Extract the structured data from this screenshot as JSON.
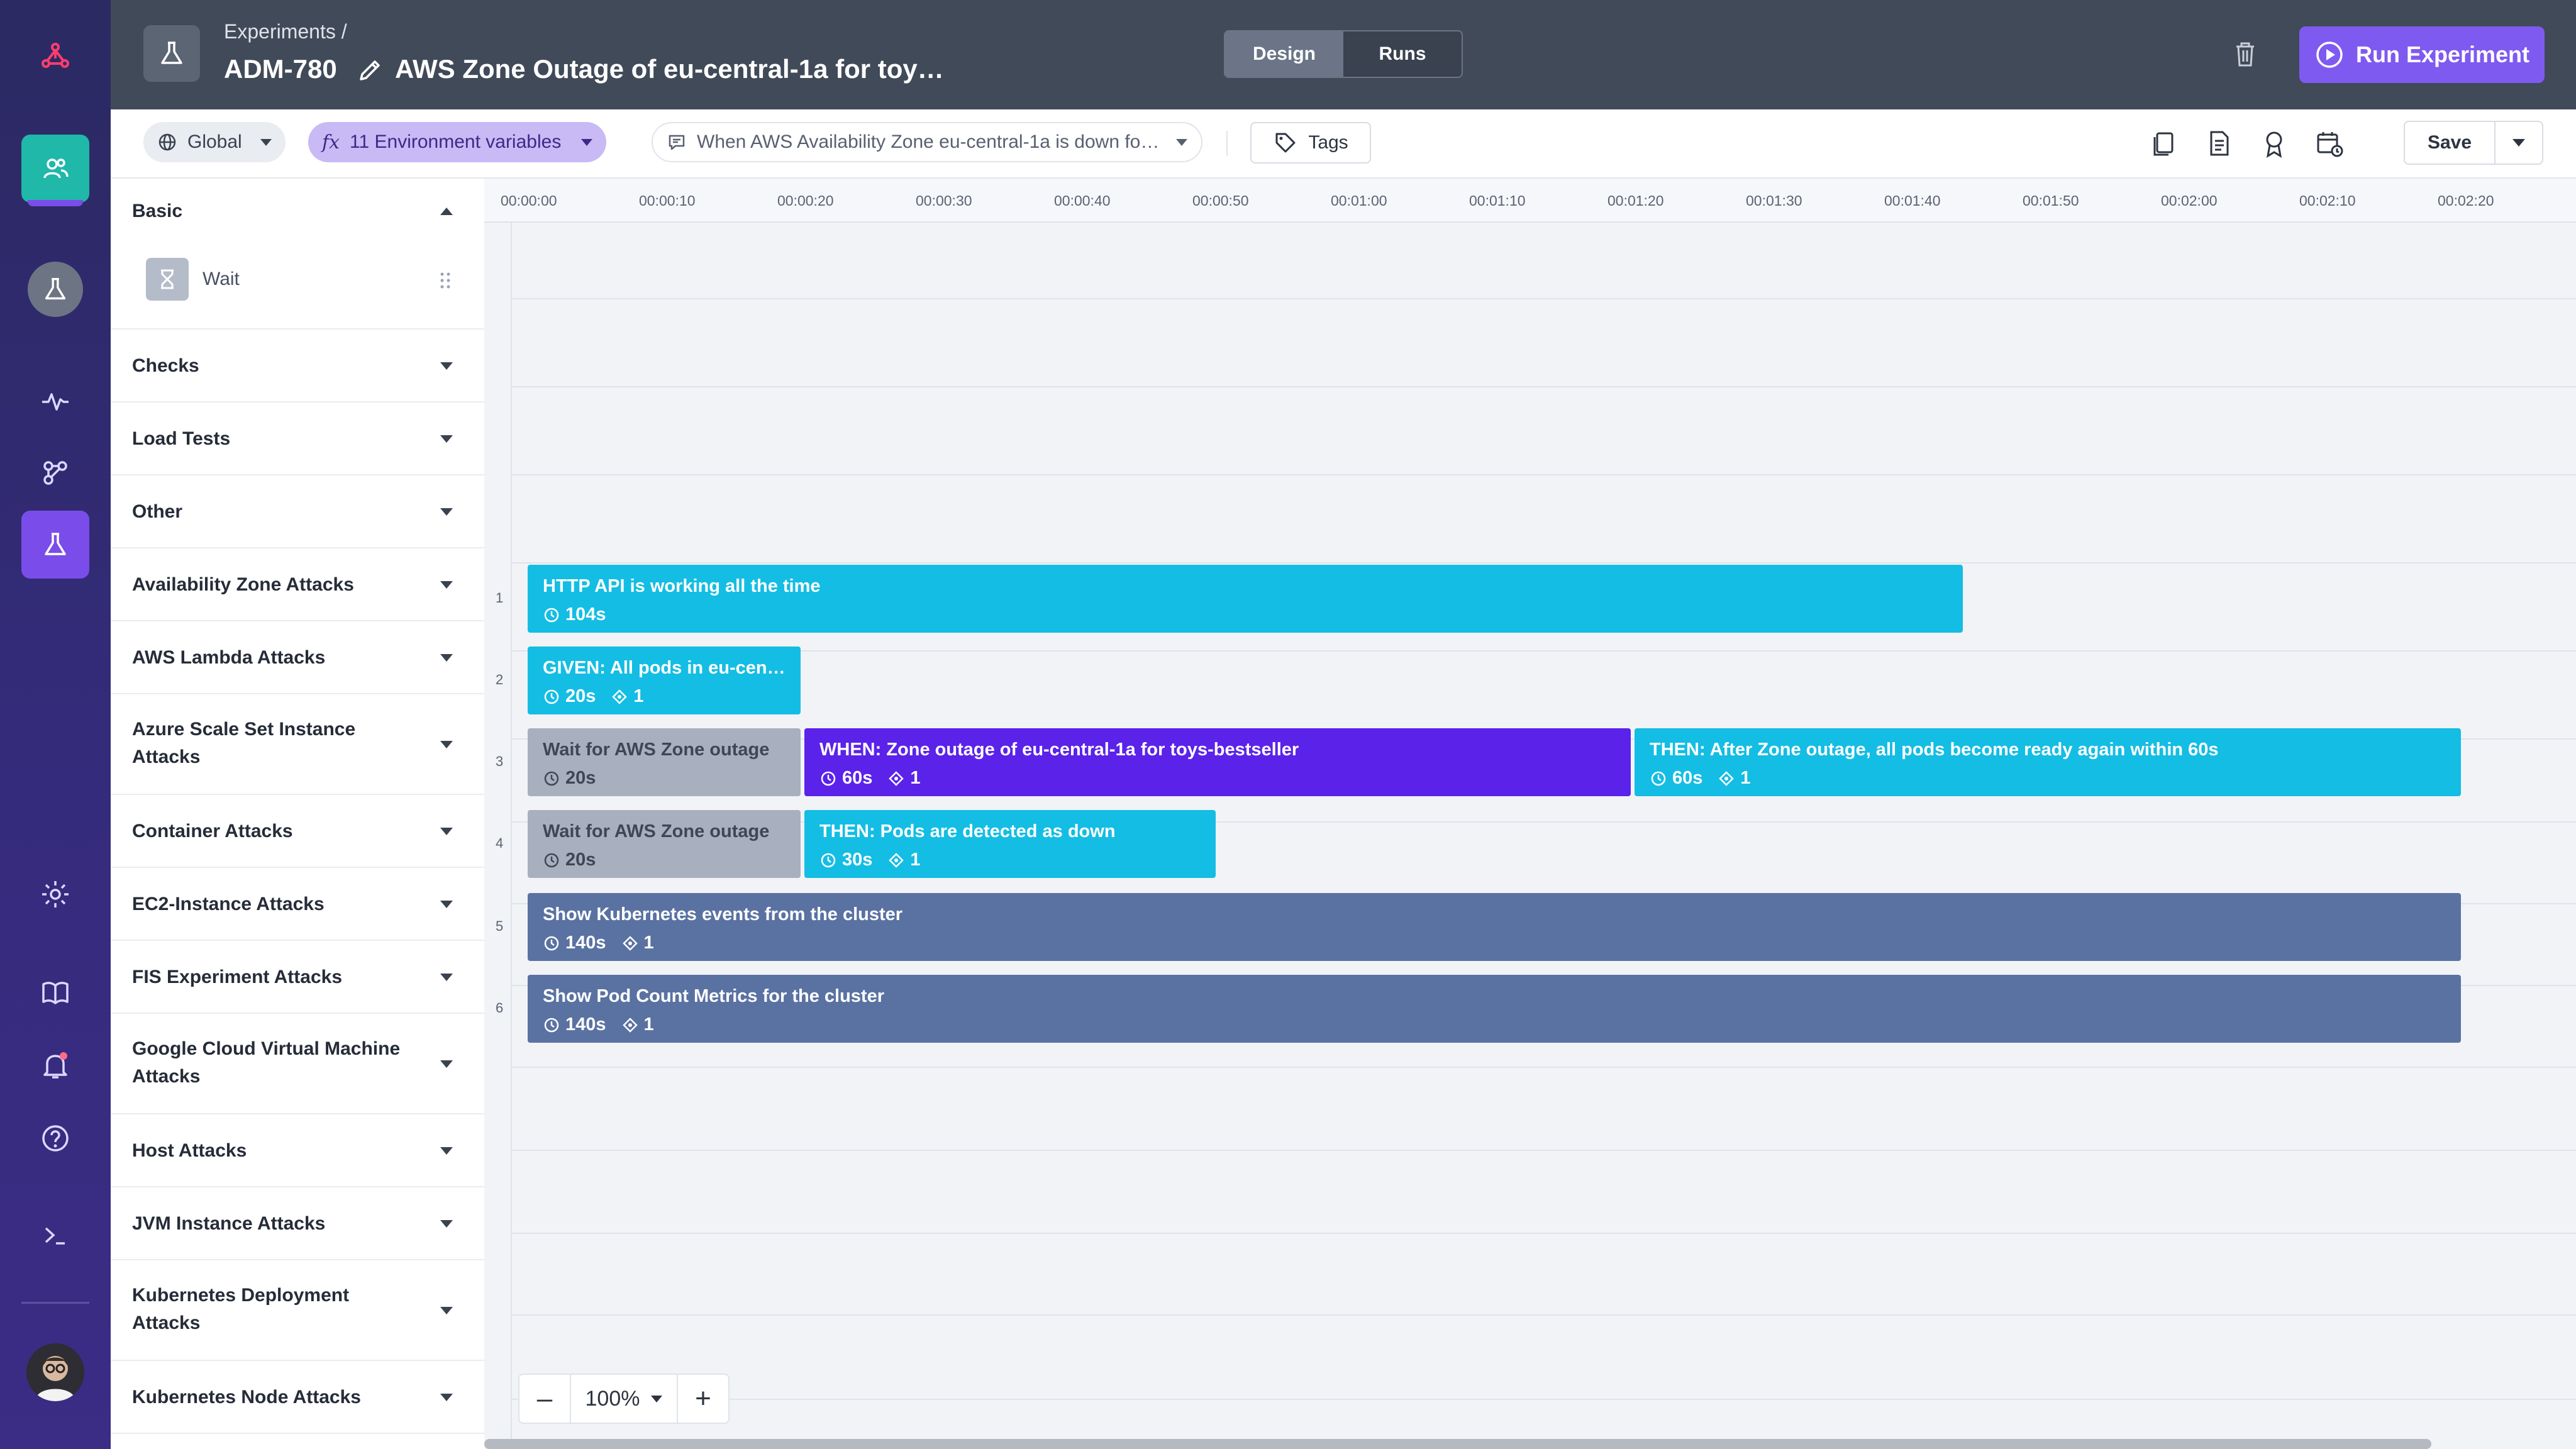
{
  "nav": {
    "items": [
      {
        "name": "logo"
      },
      {
        "name": "team"
      },
      {
        "name": "experiments-home"
      },
      {
        "name": "activity"
      },
      {
        "name": "landscape"
      },
      {
        "name": "experiments"
      },
      {
        "name": "settings"
      },
      {
        "name": "docs"
      },
      {
        "name": "notifications"
      },
      {
        "name": "help"
      },
      {
        "name": "terminal"
      },
      {
        "name": "profile"
      }
    ]
  },
  "header": {
    "breadcrumb": "Experiments /",
    "experiment_id": "ADM-780",
    "experiment_title": "AWS Zone Outage of eu-central-1a for toy…",
    "tabs": {
      "design": "Design",
      "runs": "Runs"
    },
    "run_label": "Run Experiment"
  },
  "toolbar": {
    "scope": "Global",
    "env_vars": "11 Environment variables",
    "env_prefix": "fx",
    "hypothesis": "When AWS Availability Zone eu-central-1a is down fo…",
    "tags": "Tags",
    "save": "Save"
  },
  "sidebar": {
    "sections": [
      {
        "title": "Basic",
        "expanded": true
      },
      {
        "title": "Checks"
      },
      {
        "title": "Load Tests"
      },
      {
        "title": "Other"
      },
      {
        "title": "Availability Zone Attacks"
      },
      {
        "title": "AWS Lambda Attacks"
      },
      {
        "title": "Azure Scale Set Instance Attacks"
      },
      {
        "title": "Container Attacks"
      },
      {
        "title": "EC2-Instance Attacks"
      },
      {
        "title": "FIS Experiment Attacks"
      },
      {
        "title": "Google Cloud Virtual Machine Attacks"
      },
      {
        "title": "Host Attacks"
      },
      {
        "title": "JVM Instance Attacks"
      },
      {
        "title": "Kubernetes Deployment Attacks"
      },
      {
        "title": "Kubernetes Node Attacks"
      }
    ],
    "basic_items": [
      {
        "label": "Wait"
      }
    ]
  },
  "timeline": {
    "ticks": [
      "00:00:00",
      "00:00:10",
      "00:00:20",
      "00:00:30",
      "00:00:40",
      "00:00:50",
      "00:01:00",
      "00:01:10",
      "00:01:20",
      "00:01:30",
      "00:01:40",
      "00:01:50",
      "00:02:00",
      "00:02:10",
      "00:02:20"
    ],
    "lanes": [
      "1",
      "2",
      "3",
      "4",
      "5",
      "6"
    ],
    "steps": [
      {
        "lane": 1,
        "start": 0,
        "duration": 104,
        "title": "HTTP API is working all the time",
        "duration_label": "104s",
        "kind": "check"
      },
      {
        "lane": 2,
        "start": 0,
        "duration": 20,
        "title": "GIVEN: All pods in eu-cent…",
        "duration_label": "20s",
        "count": "1",
        "kind": "check"
      },
      {
        "lane": 3,
        "start": 0,
        "duration": 20,
        "title": "Wait for AWS Zone outage",
        "duration_label": "20s",
        "kind": "wait"
      },
      {
        "lane": 3,
        "start": 20,
        "duration": 60,
        "title": "WHEN: Zone outage of eu-central-1a for toys-bestseller",
        "duration_label": "60s",
        "count": "1",
        "kind": "attack"
      },
      {
        "lane": 3,
        "start": 80,
        "duration": 60,
        "title": "THEN: After Zone outage, all pods become ready again within 60s",
        "duration_label": "60s",
        "count": "1",
        "kind": "check"
      },
      {
        "lane": 4,
        "start": 0,
        "duration": 20,
        "title": "Wait for AWS Zone outage",
        "duration_label": "20s",
        "kind": "wait"
      },
      {
        "lane": 4,
        "start": 20,
        "duration": 30,
        "title": "THEN: Pods are detected as down",
        "duration_label": "30s",
        "count": "1",
        "kind": "check"
      },
      {
        "lane": 5,
        "start": 0,
        "duration": 140,
        "title": "Show Kubernetes events from the cluster",
        "duration_label": "140s",
        "count": "1",
        "kind": "observe"
      },
      {
        "lane": 6,
        "start": 0,
        "duration": 140,
        "title": "Show Pod Count Metrics for the cluster",
        "duration_label": "140s",
        "count": "1",
        "kind": "observe"
      }
    ],
    "zoom": "100%"
  },
  "colors": {
    "accent": "#7f5af0",
    "check": "#14bde3",
    "attack": "#5b22ea",
    "wait": "#a8b0bf",
    "observe": "#5a72a2"
  }
}
